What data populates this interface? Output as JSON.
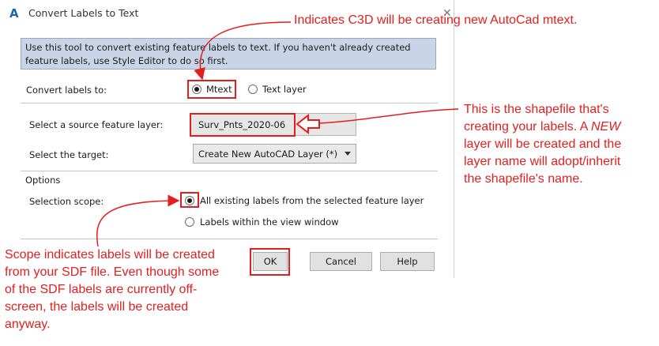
{
  "window": {
    "title": "Convert Labels to Text",
    "close_glyph": "✕"
  },
  "info_text": "Use this tool to convert existing feature labels to text.  If you haven't already created feature labels, use Style Editor to do so first.",
  "convert": {
    "label": "Convert labels to:",
    "option_mtext": "Mtext",
    "option_textlayer": "Text layer",
    "selected": "Mtext"
  },
  "source_layer": {
    "label": "Select a source feature layer:",
    "value": "Surv_Pnts_2020-06"
  },
  "target": {
    "label": "Select the target:",
    "value": "Create New AutoCAD Layer (*)"
  },
  "options": {
    "section_label": "Options",
    "scope_label": "Selection scope:",
    "scope_all": "All existing labels from the selected feature layer",
    "scope_view": "Labels within the view window",
    "selected": "all"
  },
  "buttons": {
    "ok": "OK",
    "cancel": "Cancel",
    "help": "Help"
  },
  "annotations": {
    "top": "Indicates C3D will be creating new AutoCad mtext.",
    "right_1": "This is the shapefile that's",
    "right_2_pre": "creating your labels. A ",
    "right_2_em": "NEW",
    "right_3": "layer will be created and the",
    "right_4": "layer name will adopt/inherit",
    "right_5": "the shapefile's name.",
    "left_1": "Scope indicates labels will be created",
    "left_2": "from your SDF file. Even though some",
    "left_3": "of the SDF labels are currently off-",
    "left_4": "screen, the labels will be created",
    "left_5": "anyway."
  },
  "colors": {
    "annotation_red": "#e41e1e",
    "info_bg": "#c9d5e6",
    "app_icon_blue": "#1a63b5"
  }
}
